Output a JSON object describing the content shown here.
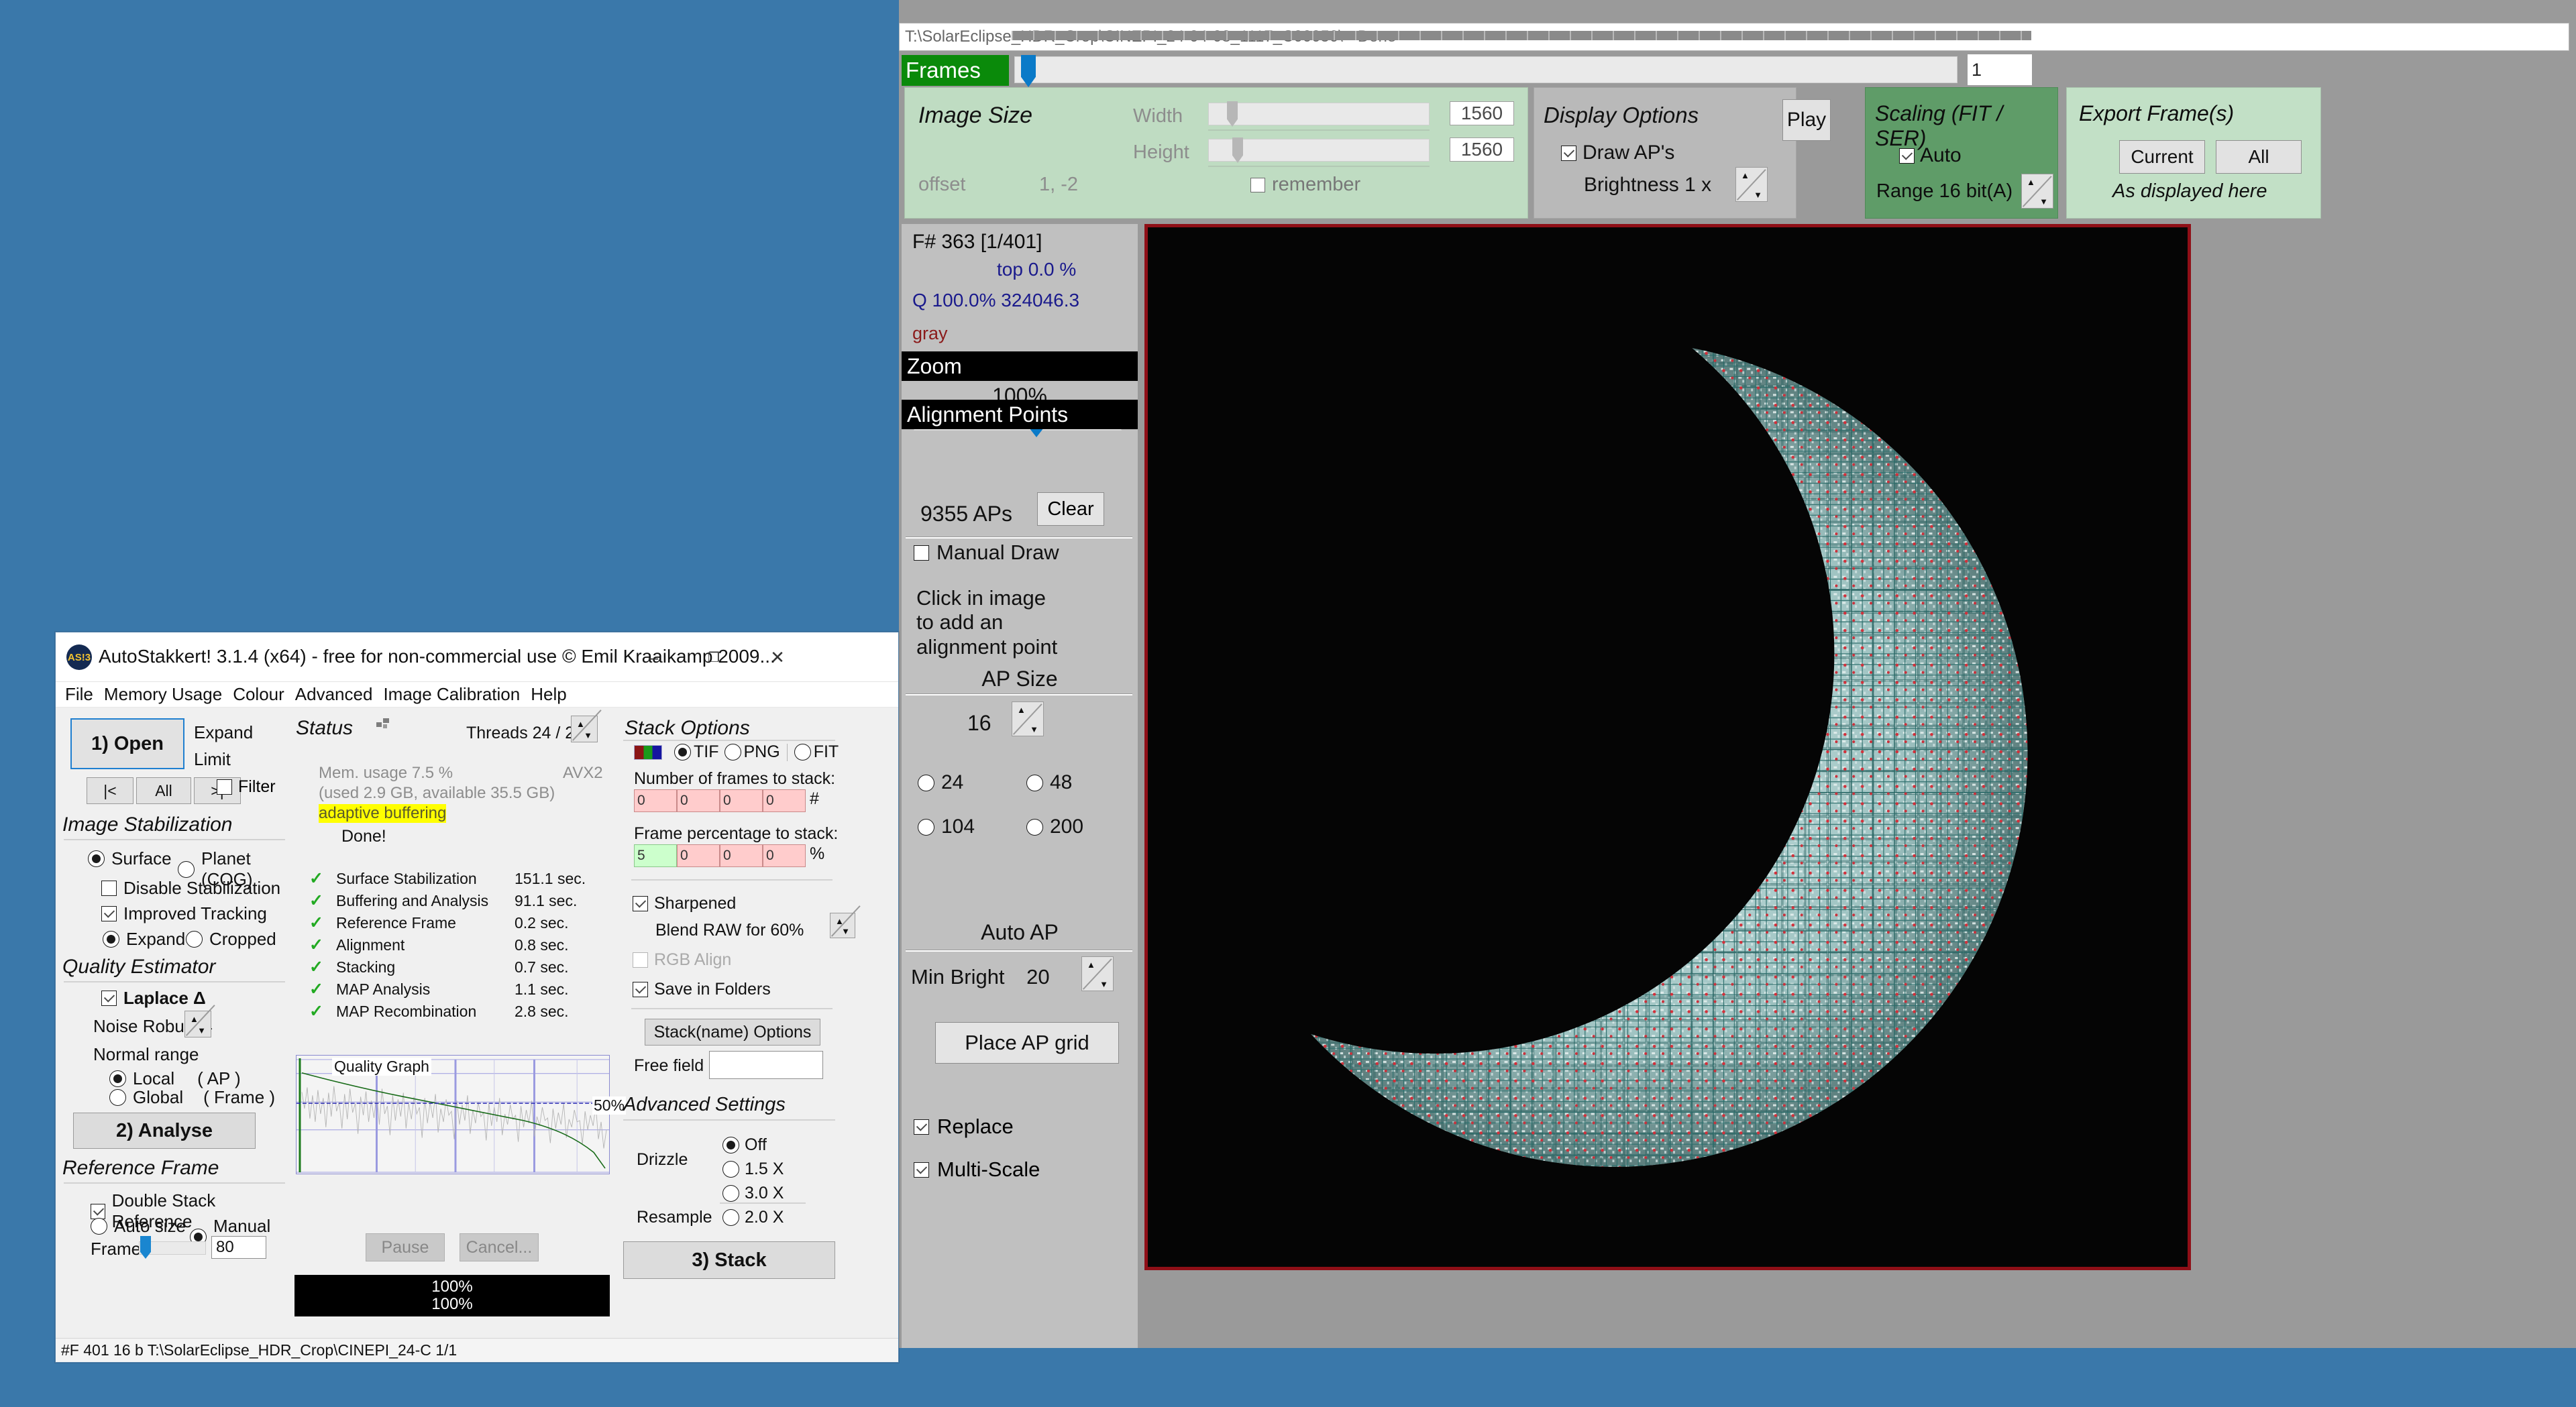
{
  "viewer": {
    "path": "T:\\SolarEclipse_HDR_Crop\\CINEPI_24-04-08_1117_C00050\\",
    "status": "Done",
    "frames_label": "Frames",
    "frame_number": "1",
    "image_size": {
      "title": "Image Size",
      "width_label": "Width",
      "width_value": "1560",
      "height_label": "Height",
      "height_value": "1560",
      "offset_label": "offset",
      "offset_value": "1, -2",
      "remember_label": "remember",
      "remember_checked": false
    },
    "display_options": {
      "title": "Display Options",
      "draw_aps_label": "Draw AP's",
      "draw_aps_checked": true,
      "brightness_label": "Brightness  1 x",
      "play_label": "Play"
    },
    "scaling": {
      "title": "Scaling (FIT / SER)",
      "auto_label": "Auto",
      "auto_checked": true,
      "range_label": "Range 16 bit(A)"
    },
    "export": {
      "title": "Export Frame(s)",
      "current_label": "Current",
      "all_label": "All",
      "note": "As displayed here"
    },
    "info": {
      "frame_line": "F# 363 [1/401]",
      "top_line": "top 0.0 %",
      "q_line": "Q 100.0%  324046.3",
      "color_line": "gray",
      "zoom_header": "Zoom",
      "zoom_value": "100%"
    },
    "alignment_points": {
      "header": "Alignment Points",
      "count_label": "9355 APs",
      "clear_label": "Clear",
      "manual_draw_label": "Manual Draw",
      "manual_draw_checked": false,
      "hint_line1": "Click in image",
      "hint_line2": "to add an",
      "hint_line3": "alignment point",
      "ap_size_header": "AP Size",
      "ap_size_value": "16",
      "ap_size_options": [
        "24",
        "48",
        "104",
        "200"
      ],
      "auto_ap_header": "Auto AP",
      "min_bright_label": "Min Bright",
      "min_bright_value": "20",
      "place_grid_label": "Place AP grid",
      "replace_label": "Replace",
      "replace_checked": true,
      "multi_scale_label": "Multi-Scale",
      "multi_scale_checked": true
    }
  },
  "autostakkert": {
    "title": "AutoStakkert! 3.1.4 (x64) - free for non-commercial use © Emil Kraaikamp 2009...",
    "logo": "AS!3",
    "window_buttons": {
      "minimize": "–",
      "maximize": "❐",
      "close": "✕"
    },
    "menu": [
      "File",
      "Memory Usage",
      "Colour",
      "Advanced",
      "Image Calibration",
      "Help"
    ],
    "left": {
      "open_label": "1) Open",
      "expand_label": "Expand",
      "limit_label": "Limit",
      "nav_first": "|<",
      "nav_all": "All",
      "nav_last": ">|",
      "filter_label": "Filter",
      "filter_checked": false,
      "image_stabilization_header": "Image Stabilization",
      "surface_label": "Surface",
      "surface_selected": true,
      "planet_label": "Planet (COG)",
      "disable_stab_label": "Disable Stabilization",
      "disable_stab_checked": false,
      "improved_tracking_label": "Improved Tracking",
      "improved_tracking_checked": true,
      "expand_radio_label": "Expand",
      "expand_radio_selected": true,
      "cropped_label": "Cropped",
      "quality_estimator_header": "Quality Estimator",
      "laplace_label": "Laplace Δ",
      "laplace_checked": true,
      "noise_robust_label": "Noise Robust  4",
      "normal_range_label": "Normal range",
      "local_label": "Local",
      "local_sub": "( AP )",
      "local_selected": true,
      "global_label": "Global",
      "global_sub": "( Frame )",
      "analyse_label": "2) Analyse",
      "reference_frame_header": "Reference Frame",
      "double_stack_label": "Double Stack Reference",
      "double_stack_checked": true,
      "auto_size_label": "Auto size",
      "manual_size_label": "Manual size",
      "manual_size_selected": true,
      "frames_label": "Frames",
      "frames_value": "80"
    },
    "status": {
      "title": "Status",
      "threads_label": "Threads 24 / 24",
      "mem_line1": "Mem. usage 7.5 %",
      "mem_line2": "(used 2.9 GB, available 35.5 GB)",
      "adaptive_buffering": "adaptive buffering",
      "avx": "AVX2",
      "done": "Done!",
      "tasks": [
        {
          "name": "Surface Stabilization",
          "time": "151.1 sec."
        },
        {
          "name": "Buffering and Analysis",
          "time": "91.1 sec."
        },
        {
          "name": "Reference Frame",
          "time": "0.2 sec."
        },
        {
          "name": "Alignment",
          "time": "0.8 sec."
        },
        {
          "name": "Stacking",
          "time": "0.7 sec."
        },
        {
          "name": "MAP Analysis",
          "time": "1.1 sec."
        },
        {
          "name": "MAP Recombination",
          "time": "2.8 sec."
        }
      ],
      "graph_label": "Quality Graph",
      "graph_50": "50%",
      "pause_label": "Pause",
      "cancel_label": "Cancel...",
      "progress1": "100%",
      "progress2": "100%"
    },
    "stack_options": {
      "title": "Stack Options",
      "format_tif": "TIF",
      "format_png": "PNG",
      "format_fit": "FIT",
      "format_selected": "TIF",
      "num_frames_label": "Number of frames to stack:",
      "num_frames_values": [
        "0",
        "0",
        "0",
        "0"
      ],
      "num_frames_unit": "#",
      "pct_label": "Frame percentage to stack:",
      "pct_values": [
        "5",
        "0",
        "0",
        "0"
      ],
      "pct_unit": "%",
      "sharpened_label": "Sharpened",
      "sharpened_checked": true,
      "blend_raw_label": "Blend RAW for   60%",
      "rgb_align_label": "RGB Align",
      "rgb_align_checked": false,
      "save_folders_label": "Save in Folders",
      "save_folders_checked": true,
      "stack_name_btn": "Stack(name) Options",
      "free_field_label": "Free field",
      "free_field_value": "",
      "advanced_header": "Advanced Settings",
      "drizzle_label": "Drizzle",
      "drizzle_off": "Off",
      "drizzle_15": "1.5 X",
      "drizzle_30": "3.0 X",
      "drizzle_selected": "Off",
      "resample_label": "Resample",
      "resample_20": "2.0 X",
      "stack_label": "3) Stack"
    },
    "status_bar": "#F 401 16 b T:\\SolarEclipse_HDR_Crop\\CINEPI_24-C 1/1"
  }
}
